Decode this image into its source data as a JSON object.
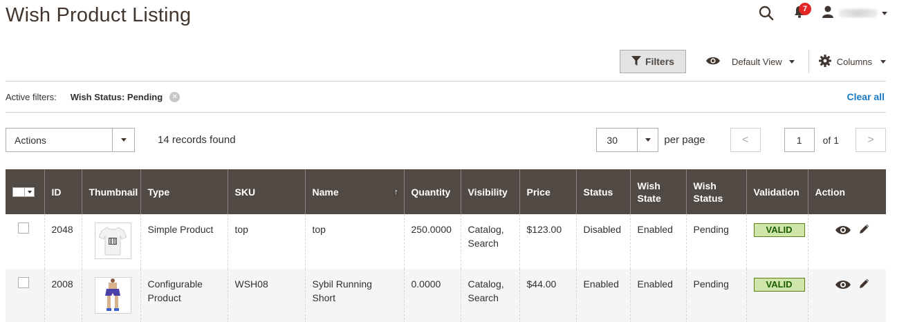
{
  "page": {
    "title": "Wish Product Listing"
  },
  "header": {
    "notification_count": "7"
  },
  "toolbar": {
    "filters_label": "Filters",
    "view_label": "Default View",
    "columns_label": "Columns"
  },
  "active_filters": {
    "label": "Active filters:",
    "items": [
      {
        "label": "Wish Status: Pending"
      }
    ],
    "clear_all": "Clear all"
  },
  "actions": {
    "label": "Actions"
  },
  "records": {
    "text": "14 records found"
  },
  "pager": {
    "per_page_value": "30",
    "per_page_label": "per page",
    "prev": "<",
    "next": ">",
    "current_page": "1",
    "of_label": "of 1"
  },
  "grid": {
    "columns": [
      "ID",
      "Thumbnail",
      "Type",
      "SKU",
      "Name",
      "Quantity",
      "Visibility",
      "Price",
      "Status",
      "Wish State",
      "Wish Status",
      "Validation",
      "Action"
    ],
    "sort_indicator": "↑",
    "rows": [
      {
        "id": "2048",
        "type": "Simple Product",
        "sku": "top",
        "name": "top",
        "quantity": "250.0000",
        "visibility": "Catalog, Search",
        "price": "$123.00",
        "status": "Disabled",
        "wish_state": "Enabled",
        "wish_status": "Pending",
        "validation": "VALID"
      },
      {
        "id": "2008",
        "type": "Configurable Product",
        "sku": "WSH08",
        "name": "Sybil Running Short",
        "quantity": "0.0000",
        "visibility": "Catalog, Search",
        "price": "$44.00",
        "status": "Enabled",
        "wish_state": "Enabled",
        "wish_status": "Pending",
        "validation": "VALID"
      }
    ]
  },
  "colors": {
    "header_bg": "#514943",
    "link": "#1979c3",
    "badge": "#e22626",
    "valid_bg": "#d0e5a9",
    "valid_border": "#5b8116"
  },
  "icons": [
    "search-icon",
    "bell-icon",
    "user-icon",
    "filter-icon",
    "eye-icon",
    "gear-icon",
    "pencil-icon",
    "close-icon",
    "chevron-left-icon",
    "chevron-right-icon"
  ]
}
